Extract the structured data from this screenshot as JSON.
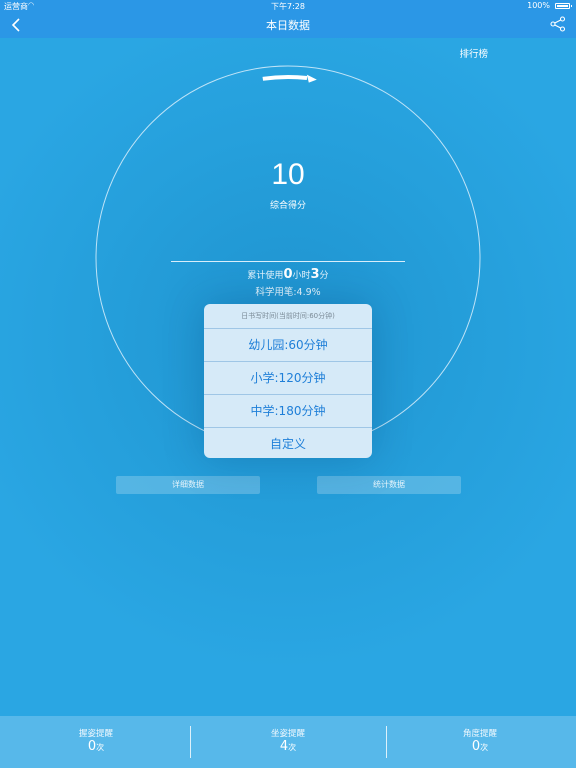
{
  "status_bar": {
    "carrier": "运营商",
    "time": "下午7:28",
    "battery": "100%"
  },
  "nav": {
    "title": "本日数据"
  },
  "ranking_label": "排行榜",
  "score": {
    "value": "10",
    "label": "综合得分",
    "progress_fraction": 0.13
  },
  "usage": {
    "prefix": "累计使用",
    "hours": "0",
    "hours_unit": "小时",
    "minutes": "3",
    "minutes_unit": "分"
  },
  "science_pen": "科学用笔:4.9%",
  "buttons": {
    "detail": "详细数据",
    "stats": "统计数据"
  },
  "sheet": {
    "header": "日书写时间(当前时间:60分钟)",
    "options": [
      "幼儿园:60分钟",
      "小学:120分钟",
      "中学:180分钟",
      "自定义"
    ]
  },
  "bottom": [
    {
      "label": "握姿提醒",
      "value": "0",
      "unit": "次"
    },
    {
      "label": "坐姿提醒",
      "value": "4",
      "unit": "次"
    },
    {
      "label": "角度提醒",
      "value": "0",
      "unit": "次"
    }
  ],
  "colors": {
    "background": "#2aa6e3",
    "nav": "#2b97e6",
    "sheet_text": "#1f7fd8",
    "bottom_bar": "#57b8ea"
  },
  "icons": {
    "back": "chevron-left-icon",
    "share": "share-icon",
    "wifi": "wifi-icon",
    "battery": "battery-icon"
  }
}
